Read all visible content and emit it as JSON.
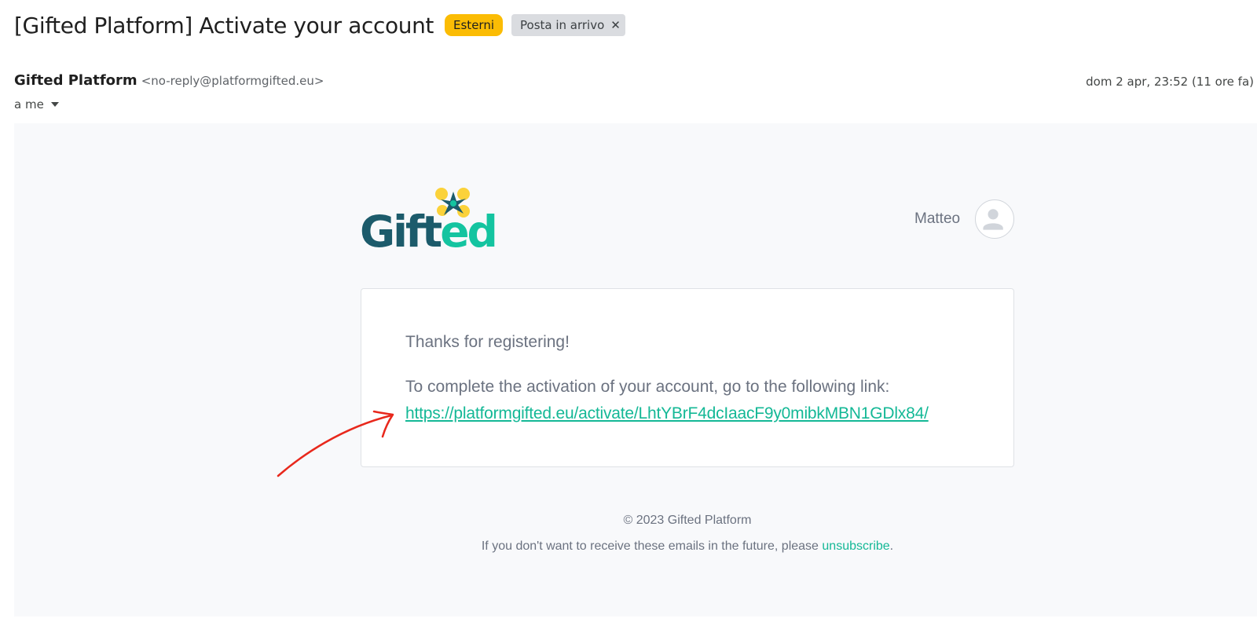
{
  "message": {
    "subject": "[Gifted Platform] Activate your account",
    "labels": [
      {
        "text": "Esterni",
        "color": "#fbbc04"
      },
      {
        "text": "Posta in arrivo",
        "color": "#dadce0",
        "removable": true
      }
    ],
    "sender_name": "Gifted Platform",
    "sender_email": "<no-reply@platformgifted.eu>",
    "date": "dom 2 apr, 23:52 (11 ore fa)",
    "recipient": "a me"
  },
  "email_body": {
    "brand": {
      "part1": "Gift",
      "part2": "ed"
    },
    "brand_colors": {
      "dark": "#1c5b6b",
      "accent": "#14c4a0",
      "petal": "#fbd23a"
    },
    "user_name": "Matteo",
    "greeting": "Thanks for registering!",
    "instruction": "To complete the activation of your account, go to the following link:",
    "activation_link": "https://platformgifted.eu/activate/LhtYBrF4dcIaacF9y0mibkMBN1GDlx84/",
    "footer_copyright": "© 2023 Gifted Platform",
    "footer_unsubscribe_prefix": "If you don't want to receive these emails in the future, please ",
    "footer_unsubscribe_link": "unsubscribe",
    "footer_unsubscribe_suffix": "."
  },
  "annotation": {
    "icon": "red-arrow-icon",
    "color": "#e8281c"
  }
}
